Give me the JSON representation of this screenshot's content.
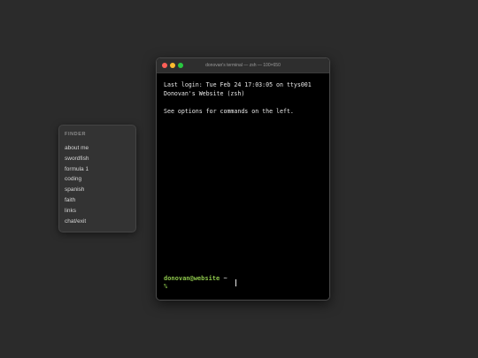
{
  "finder": {
    "title": "FINDER",
    "items": [
      {
        "label": "about me"
      },
      {
        "label": "swordfish"
      },
      {
        "label": "formula 1"
      },
      {
        "label": "coding"
      },
      {
        "label": "spanish"
      },
      {
        "label": "faith"
      },
      {
        "label": "links"
      },
      {
        "label": "chat/exit"
      }
    ]
  },
  "terminal": {
    "window_title": "donovan's terminal — zsh — 100×650",
    "lines": [
      "Last login: Tue Feb 24 17:03:05 on ttys001",
      "Donovan's Website (zsh)",
      "See options for commands on the left."
    ],
    "prompt_user": "donovan@website",
    "prompt_dir": "~",
    "prompt_symbol": "%"
  },
  "colors": {
    "background": "#2b2b2b",
    "prompt_green": "#8bc34a",
    "close": "#ff5f57",
    "minimize": "#febc2e",
    "zoom": "#28c840"
  }
}
